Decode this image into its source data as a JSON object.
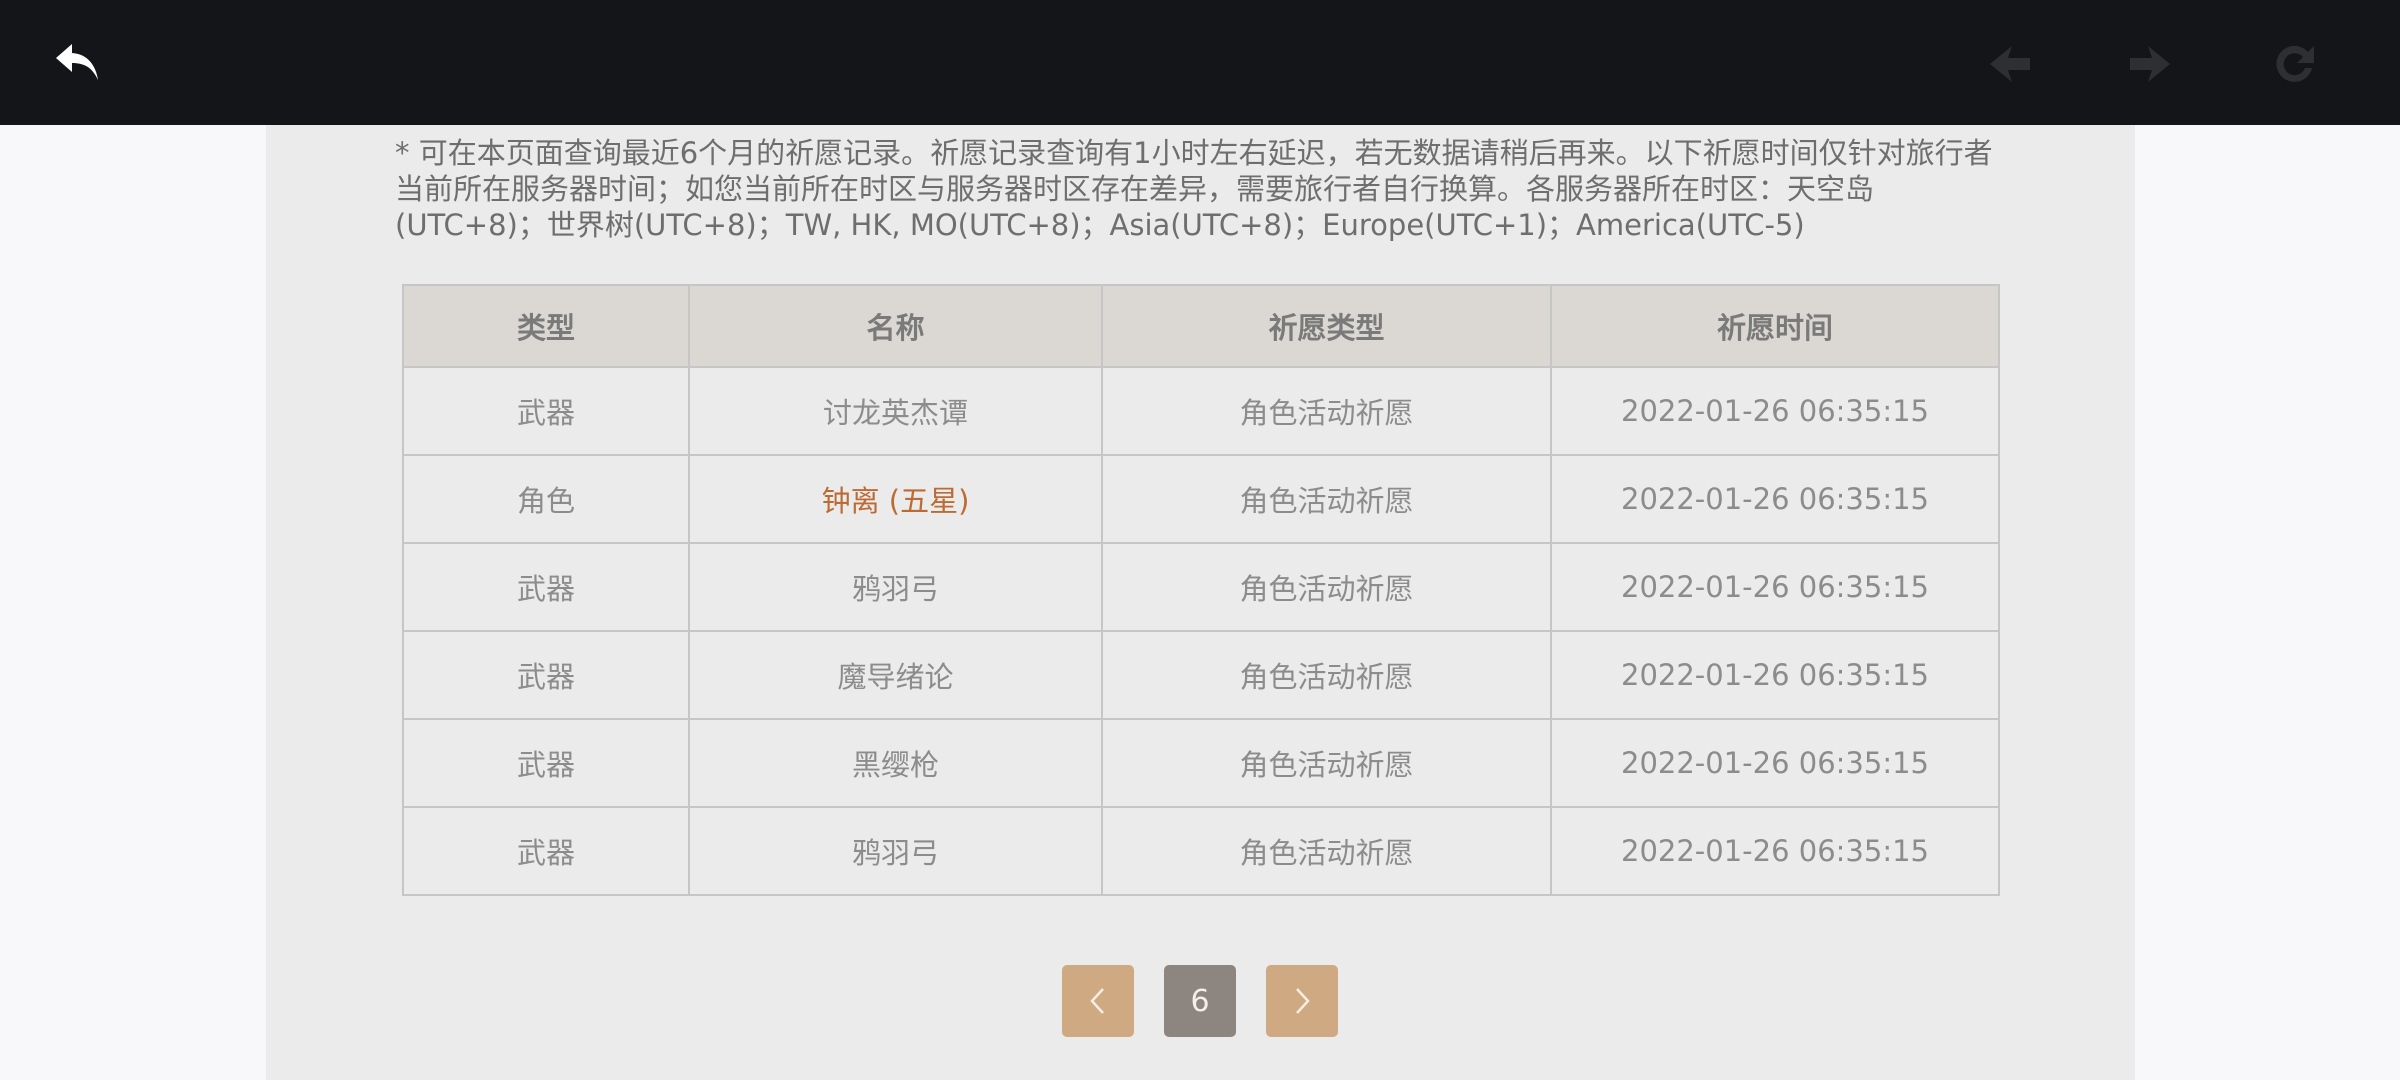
{
  "notice": {
    "text": "* 可在本页面查询最近6个月的祈愿记录。祈愿记录查询有1小时左右延迟，若无数据请稍后再来。以下祈愿时间仅针对旅行者当前所在服务器时间；如您当前所在时区与服务器时区存在差异，需要旅行者自行换算。各服务器所在时区：天空岛(UTC+8)；世界树(UTC+8)；TW, HK, MO(UTC+8)；Asia(UTC+8)；Europe(UTC+1)；America(UTC-5)"
  },
  "table": {
    "headers": [
      "类型",
      "名称",
      "祈愿类型",
      "祈愿时间"
    ],
    "rows": [
      {
        "type": "武器",
        "name": "讨龙英杰谭",
        "wish": "角色活动祈愿",
        "time": "2022-01-26 06:35:15"
      },
      {
        "type": "角色",
        "name": "钟离 (五星)",
        "wish": "角色活动祈愿",
        "time": "2022-01-26 06:35:15"
      },
      {
        "type": "武器",
        "name": "鸦羽弓",
        "wish": "角色活动祈愿",
        "time": "2022-01-26 06:35:15"
      },
      {
        "type": "武器",
        "name": "魔导绪论",
        "wish": "角色活动祈愿",
        "time": "2022-01-26 06:35:15"
      },
      {
        "type": "武器",
        "name": "黑缨枪",
        "wish": "角色活动祈愿",
        "time": "2022-01-26 06:35:15"
      },
      {
        "type": "武器",
        "name": "鸦羽弓",
        "wish": "角色活动祈愿",
        "time": "2022-01-26 06:35:15"
      }
    ]
  },
  "pagination": {
    "prev_icon": "chevron-left-icon",
    "page": "6",
    "next_icon": "chevron-right-icon"
  },
  "toolbar": {
    "back_icon": "back-arrow-icon",
    "prev_icon": "browser-back-icon",
    "next_icon": "browser-forward-icon",
    "refresh_icon": "refresh-icon"
  },
  "colors": {
    "topbar": "#141518",
    "panel": "#ebebeb",
    "header_bg": "#dbd8d3",
    "five_star": "#bd6b34",
    "pager_active": "#cfa982",
    "pager_current": "#8d8680"
  }
}
